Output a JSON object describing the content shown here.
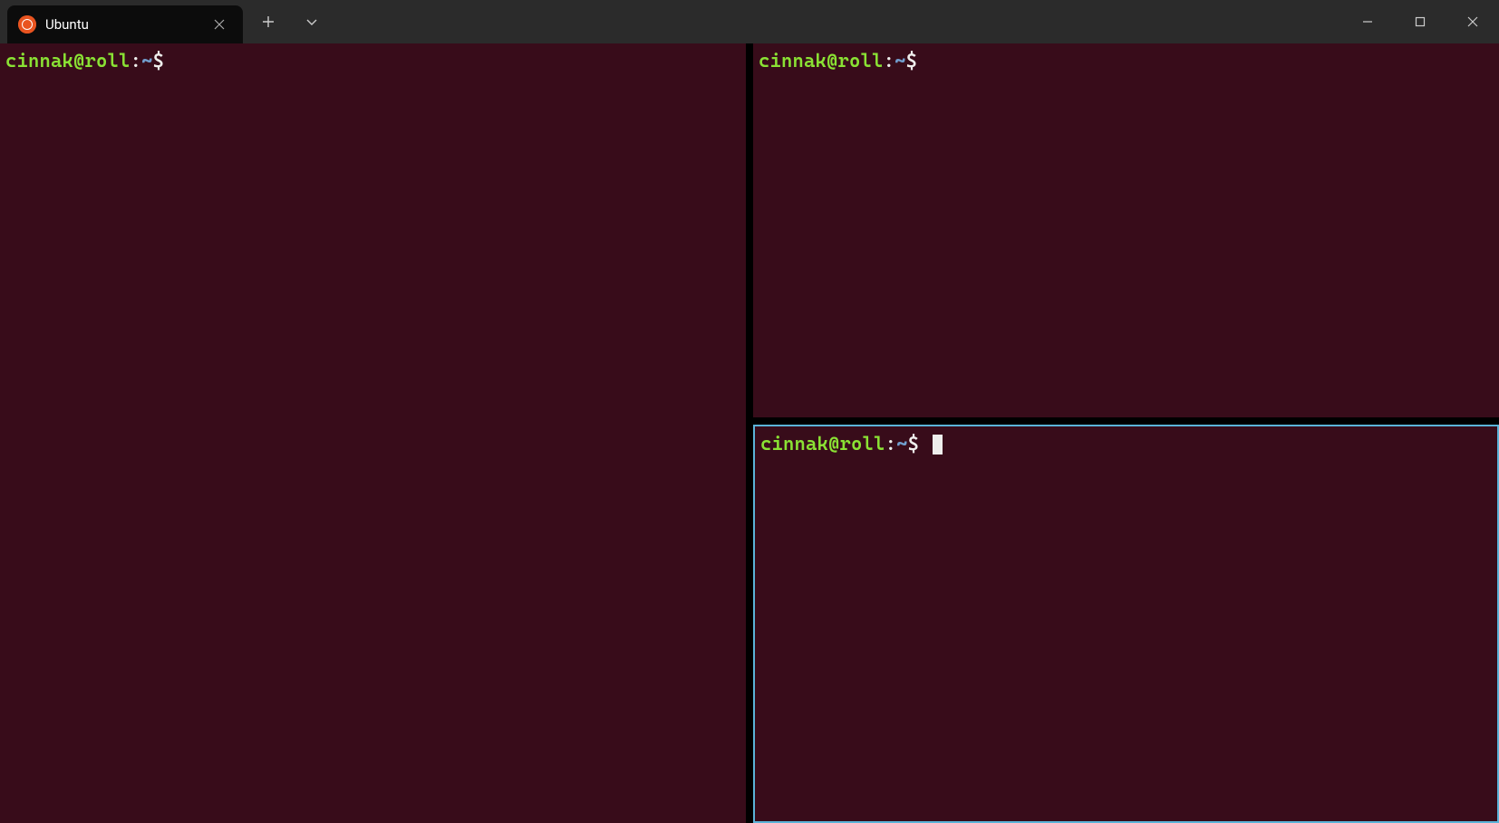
{
  "window": {
    "tabs": [
      {
        "title": "Ubuntu",
        "icon": "ubuntu-logo"
      }
    ]
  },
  "colors": {
    "prompt_user": "#8ae234",
    "prompt_path": "#729fcf",
    "prompt_text": "#eeeeec",
    "terminal_bg": "#380c1a",
    "active_pane_border": "#5bb3d8"
  },
  "panes": {
    "layout": "vertical-split",
    "active_pane": 2,
    "items": [
      {
        "id": 0,
        "position": "left",
        "prompt": {
          "user_host": "cinnak@roll",
          "sep": ":",
          "path": "~",
          "symbol": "$"
        },
        "input": "",
        "active": false
      },
      {
        "id": 1,
        "position": "right-top",
        "prompt": {
          "user_host": "cinnak@roll",
          "sep": ":",
          "path": "~",
          "symbol": "$"
        },
        "input": "",
        "active": false
      },
      {
        "id": 2,
        "position": "right-bottom",
        "prompt": {
          "user_host": "cinnak@roll",
          "sep": ":",
          "path": "~",
          "symbol": "$"
        },
        "input": "",
        "active": true
      }
    ]
  }
}
